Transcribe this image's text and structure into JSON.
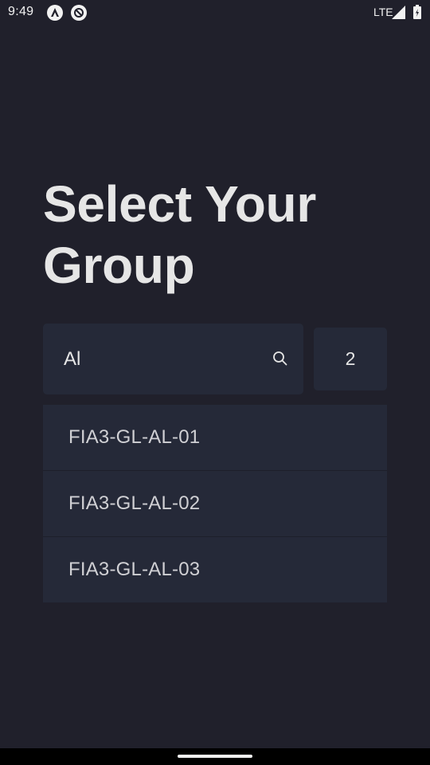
{
  "status_bar": {
    "time": "9:49",
    "network": "LTE",
    "icons": [
      "app-a-icon",
      "app-sync-icon",
      "signal-icon",
      "battery-icon"
    ]
  },
  "page": {
    "title": "Select Your Group"
  },
  "search": {
    "value": "Al",
    "icon": "search-icon"
  },
  "results_count": "2",
  "results": [
    {
      "label": "FIA3-GL-AL-01"
    },
    {
      "label": "FIA3-GL-AL-02"
    },
    {
      "label": "FIA3-GL-AL-03"
    }
  ],
  "colors": {
    "background": "#20202b",
    "surface": "#252938",
    "text": "#e6e6e6"
  }
}
